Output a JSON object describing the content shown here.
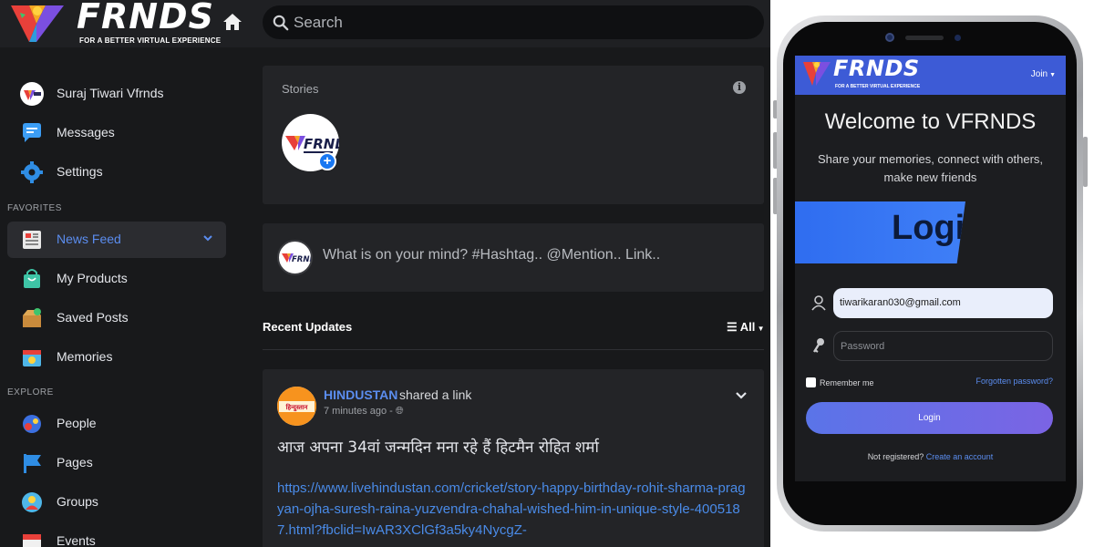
{
  "app": {
    "logo": {
      "wordmark": "FRNDS",
      "tagline": "FOR A BETTER VIRTUAL EXPERIENCE"
    },
    "search": {
      "placeholder": "Search"
    },
    "sidebar": {
      "profile": {
        "label": "Suraj Tiwari Vfrnds"
      },
      "items_top": [
        {
          "label": "Messages",
          "icon": "messages-icon"
        },
        {
          "label": "Settings",
          "icon": "settings-icon"
        }
      ],
      "favorites_label": "FAVORITES",
      "favorites": [
        {
          "label": "News Feed",
          "icon": "newsfeed-icon",
          "active": true
        },
        {
          "label": "My Products",
          "icon": "products-icon"
        },
        {
          "label": "Saved Posts",
          "icon": "saved-icon"
        },
        {
          "label": "Memories",
          "icon": "memories-icon"
        }
      ],
      "explore_label": "EXPLORE",
      "explore": [
        {
          "label": "People",
          "icon": "people-icon"
        },
        {
          "label": "Pages",
          "icon": "pages-icon"
        },
        {
          "label": "Groups",
          "icon": "groups-icon"
        },
        {
          "label": "Events",
          "icon": "events-icon"
        }
      ]
    },
    "stories": {
      "title": "Stories"
    },
    "composer": {
      "placeholder": "What is on your mind? #Hashtag.. @Mention.. Link.."
    },
    "recent": {
      "title": "Recent Updates",
      "filter": "All"
    },
    "post": {
      "author": "HINDUSTAN",
      "action": "shared a link",
      "time": "7 minutes ago -",
      "avatar_text": "हिन्दुस्तान",
      "text": "आज अपना 34वां जन्मदिन मना रहे हैं हिटमैन रोहित शर्मा",
      "link": "https://www.livehindustan.com/cricket/story-happy-birthday-rohit-sharma-pragyan-ojha-suresh-raina-yuzvendra-chahal-wished-him-in-unique-style-4005187.html?fbclid=IwAR3XClGf3a5ky4NycgZ-"
    }
  },
  "phone": {
    "logo": {
      "wordmark": "FRNDS",
      "tagline": "FOR A BETTER VIRTUAL EXPERIENCE"
    },
    "join_label": "Join",
    "welcome": "Welcome to VFRNDS",
    "subtitle": "Share your memories, connect with others, make new friends",
    "banner_text": "Login",
    "email_value": "tiwarikaran030@gmail.com",
    "password_placeholder": "Password",
    "remember_label": "Remember me",
    "forgot_label": "Forgotten password?",
    "login_button": "Login",
    "not_registered": "Not registered?",
    "create_account": "Create an account"
  },
  "colors": {
    "accent": "#5b8def",
    "background": "#18191b",
    "card": "#232427",
    "phone_header": "#3d5bd6"
  }
}
